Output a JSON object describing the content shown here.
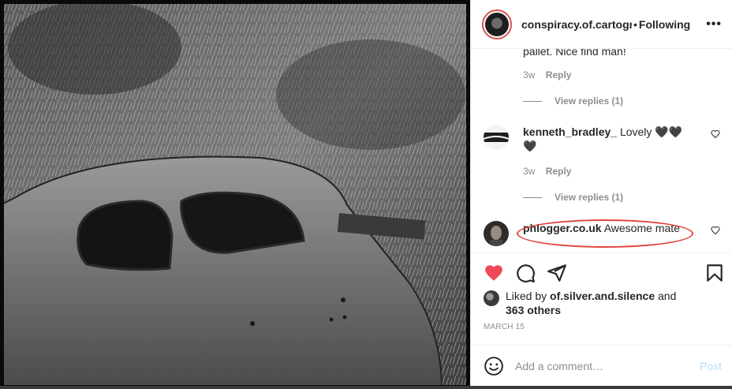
{
  "post": {
    "photo_alt": "black and white photo of abandoned car in grass",
    "header": {
      "username": "conspiracy.of.cartographers",
      "separator": "•",
      "follow_status": "Following",
      "more_icon": "more-horizontal-icon"
    }
  },
  "comments": {
    "cut_text": "pallet. Nice find man!",
    "first_meta": {
      "time": "3w",
      "reply": "Reply"
    },
    "first_view_replies": "View replies (1)",
    "items": [
      {
        "username": "kenneth_bradley_",
        "text": "Lovely 🖤🖤🖤",
        "time": "3w",
        "reply": "Reply",
        "view_replies": "View replies (1)"
      },
      {
        "username": "phlogger.co.uk",
        "text": "Awesome mate"
      }
    ]
  },
  "actions": {
    "like_icon": "heart-filled-icon",
    "comment_icon": "comment-icon",
    "share_icon": "share-icon",
    "save_icon": "bookmark-icon",
    "like_color": "#ed4956"
  },
  "likes": {
    "prefix": "Liked by ",
    "user": "of.silver.and.silence",
    "and": " and",
    "others": "363 others"
  },
  "date": "MARCH 15",
  "add_comment": {
    "placeholder": "Add a comment…",
    "post_label": "Post"
  },
  "colors": {
    "highlight_ellipse": "#e0453d",
    "post_disabled": "#b2dffc"
  }
}
